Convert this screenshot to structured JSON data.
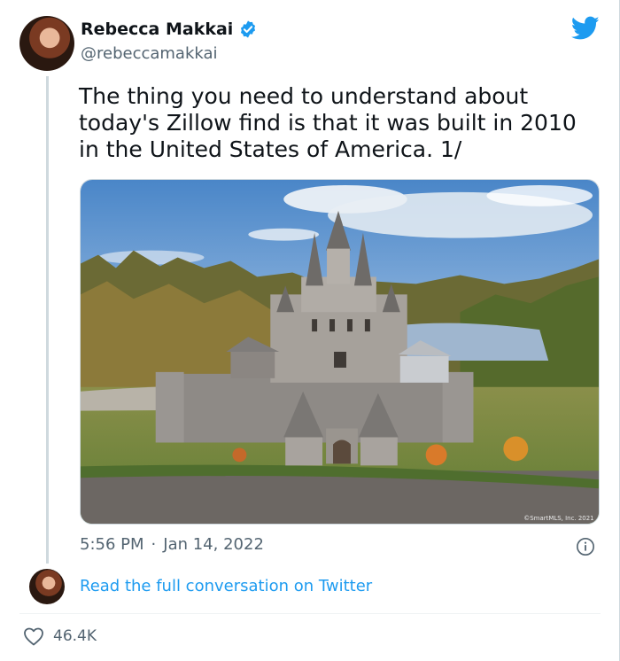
{
  "author": {
    "name": "Rebecca Makkai",
    "handle": "@rebeccamakkai"
  },
  "tweet": {
    "text": "The thing you need to understand about\ntoday's Zillow find is that it was built in 2010\nin the United States of America. 1/",
    "photo_watermark": "©SmartMLS, Inc. 2021",
    "time": "5:56 PM",
    "separator": "·",
    "date": "Jan 14, 2022"
  },
  "footer": {
    "read_link": "Read the full conversation on Twitter",
    "likes": "46.4K"
  },
  "icons": {
    "verified": "verified-badge-icon",
    "brand": "twitter-bird-icon",
    "info": "info-icon",
    "like": "heart-icon"
  },
  "colors": {
    "accent": "#1d9bf0",
    "text": "#0f1419",
    "muted": "#536471"
  }
}
